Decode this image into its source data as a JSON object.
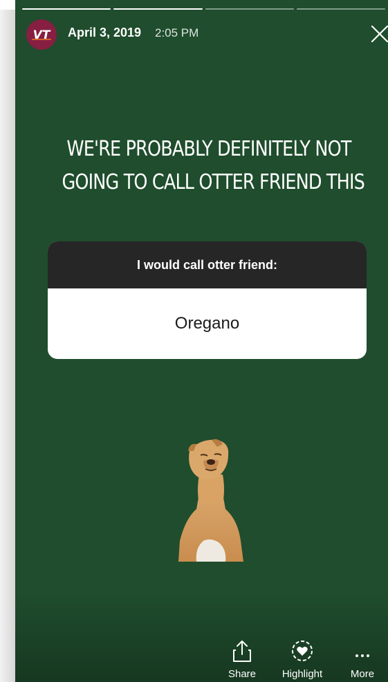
{
  "header": {
    "date": "April 3, 2019",
    "time": "2:05 PM",
    "avatar_text": "VT",
    "avatar_color": "#861f41"
  },
  "story": {
    "background_color": "#1f4d2d",
    "progress": {
      "segments": 4,
      "current": 2
    },
    "headline_line1": "WE'RE PROBABLY DEFINITELY NOT",
    "headline_line2": "GOING TO CALL OTTER FRIEND THIS"
  },
  "question_card": {
    "question": "I would call otter friend:",
    "answer": "Oregano"
  },
  "actions": {
    "share_label": "Share",
    "highlight_label": "Highlight",
    "more_label": "More"
  },
  "icons": [
    "vt-logo-icon",
    "close-icon",
    "share-icon",
    "highlight-heart-icon",
    "more-dots-icon"
  ]
}
